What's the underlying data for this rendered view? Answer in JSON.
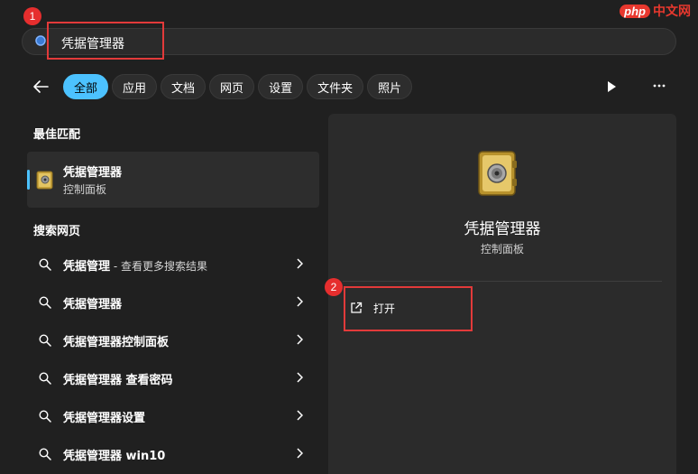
{
  "watermark": {
    "php": "php",
    "cn": "中文网"
  },
  "annotations": {
    "badge1": "1",
    "badge2": "2"
  },
  "search": {
    "query": "凭据管理器"
  },
  "filters": {
    "items": [
      "全部",
      "应用",
      "文档",
      "网页",
      "设置",
      "文件夹",
      "照片"
    ],
    "active_index": 0
  },
  "best_match": {
    "section_title": "最佳匹配",
    "name": "凭据管理器",
    "sub": "控制面板"
  },
  "web_search": {
    "section_title": "搜索网页",
    "items": [
      {
        "text": "凭据管理",
        "suffix": " - 查看更多搜索结果"
      },
      {
        "text": "凭据管理器",
        "suffix": ""
      },
      {
        "text": "凭据管理器控制面板",
        "suffix": ""
      },
      {
        "text": "凭据管理器 查看密码",
        "suffix": ""
      },
      {
        "text": "凭据管理器设置",
        "suffix": ""
      },
      {
        "text": "凭据管理器 win10",
        "suffix": ""
      }
    ]
  },
  "detail": {
    "name": "凭据管理器",
    "sub": "控制面板",
    "open_label": "打开"
  },
  "colors": {
    "accent": "#4cc2ff",
    "annotation_red": "#e23a3a",
    "background": "#202020"
  }
}
